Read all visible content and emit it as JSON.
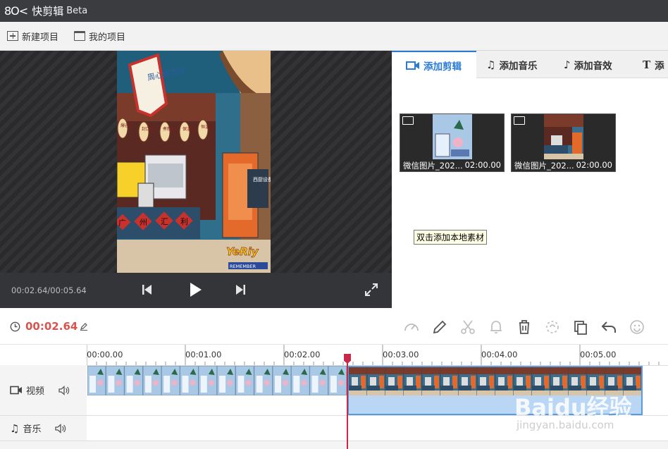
{
  "titlebar": {
    "logo": "8O<",
    "app_name": "快剪辑",
    "beta": "Beta"
  },
  "menubar": {
    "new_project": "新建项目",
    "my_projects": "我的项目"
  },
  "preview": {
    "frame": {
      "banner": "周心做西厨",
      "lanterns": [
        "爆谷机",
        "封口机",
        "煮粉机",
        "保温机",
        "恒温机"
      ],
      "counter": [
        "广",
        "州",
        "汇",
        "利"
      ],
      "signboard": "西厨设备",
      "logo_word": "YeRiy",
      "logo_sub": "REMEMBER"
    },
    "time": "00:02.64/00:05.64"
  },
  "tabs": [
    "添加剪辑",
    "添加音乐",
    "添加音效",
    "添"
  ],
  "clips": [
    {
      "name": "微信图片_202...",
      "duration": "02:00.00"
    },
    {
      "name": "微信图片_202...",
      "duration": "02:00.00"
    }
  ],
  "tooltip": "双击添加本地素材",
  "timeline": {
    "current_time": "00:02.64",
    "ticks": [
      "00:00.00",
      "00:01.00",
      "00:02.00",
      "00:03.00",
      "00:04.00",
      "00:05.00"
    ],
    "tracks": {
      "video": "视频",
      "music": "音乐"
    }
  },
  "watermark": {
    "brand": "Baidu经验",
    "url": "jingyan.baidu.com"
  },
  "colors": {
    "accent": "#2a7bd5",
    "time": "#d9534f",
    "playhead": "#c8294a",
    "selection": "#b9d7f5"
  }
}
